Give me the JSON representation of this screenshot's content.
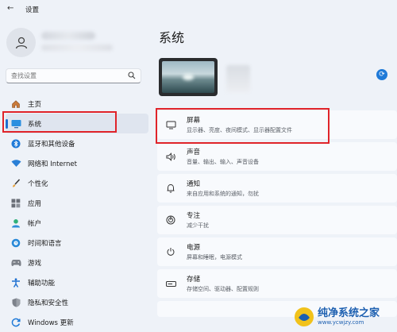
{
  "window": {
    "title": "设置"
  },
  "search": {
    "placeholder": "查找设置"
  },
  "nav": {
    "items": [
      {
        "label": "主页",
        "icon": "home-icon"
      },
      {
        "label": "系统",
        "icon": "system-display-icon"
      },
      {
        "label": "蓝牙和其他设备",
        "icon": "bluetooth-icon"
      },
      {
        "label": "网络和 Internet",
        "icon": "wifi-icon"
      },
      {
        "label": "个性化",
        "icon": "brush-icon"
      },
      {
        "label": "应用",
        "icon": "apps-icon"
      },
      {
        "label": "帐户",
        "icon": "account-icon"
      },
      {
        "label": "时间和语言",
        "icon": "globe-clock-icon"
      },
      {
        "label": "游戏",
        "icon": "gamepad-icon"
      },
      {
        "label": "辅助功能",
        "icon": "accessibility-icon"
      },
      {
        "label": "隐私和安全性",
        "icon": "shield-icon"
      },
      {
        "label": "Windows 更新",
        "icon": "windows-update-icon"
      }
    ],
    "active_index": 1
  },
  "main": {
    "title": "系统",
    "cards": [
      {
        "title": "屏幕",
        "subtitle": "显示器、亮度、夜间模式、显示器配置文件",
        "icon": "monitor-icon"
      },
      {
        "title": "声音",
        "subtitle": "音量、输出、输入、声音设备",
        "icon": "speaker-icon"
      },
      {
        "title": "通知",
        "subtitle": "来自应用和系统的通知，勿扰",
        "icon": "bell-icon"
      },
      {
        "title": "专注",
        "subtitle": "减少干扰",
        "icon": "focus-icon"
      },
      {
        "title": "电源",
        "subtitle": "屏幕和睡眠，电源模式",
        "icon": "power-icon"
      },
      {
        "title": "存储",
        "subtitle": "存储空间、驱动器、配置规则",
        "icon": "storage-icon"
      },
      {
        "title": "",
        "subtitle": "",
        "icon": ""
      }
    ]
  },
  "watermark": {
    "title": "纯净系统之家",
    "url": "www.ycwjzy.com"
  },
  "colors": {
    "accent": "#1f6fd0",
    "highlight_box": "#e0242a",
    "background": "#eef2f8",
    "card": "#f8fafd"
  }
}
